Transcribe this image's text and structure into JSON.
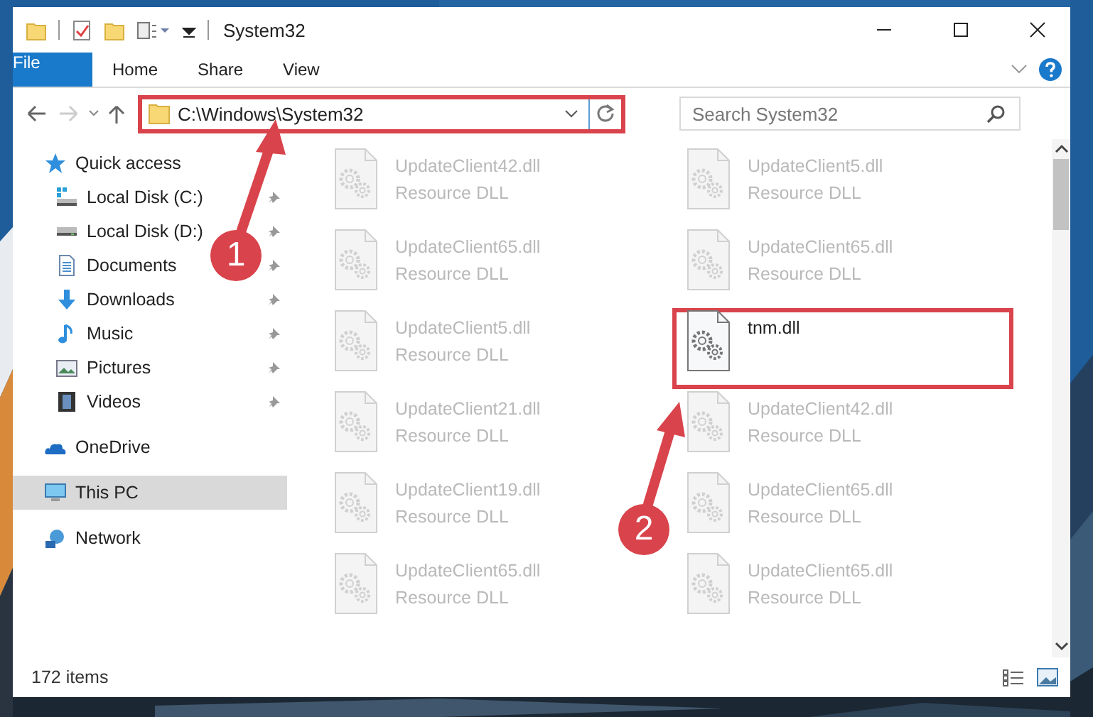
{
  "window": {
    "title": "System32"
  },
  "ribbon": {
    "tabs": [
      {
        "label": "File",
        "kind": "file",
        "selected": false
      },
      {
        "label": "Home",
        "kind": "tab",
        "selected": false
      },
      {
        "label": "Share",
        "kind": "tab",
        "selected": false
      },
      {
        "label": "View",
        "kind": "tab",
        "selected": false
      }
    ]
  },
  "address_bar": {
    "path": "C:\\Windows\\System32",
    "highlighted": true
  },
  "search": {
    "placeholder": "Search System32"
  },
  "navigation": {
    "items": [
      {
        "label": "Quick access",
        "kind": "star",
        "selected": false,
        "children": [
          {
            "label": "Local Disk (C:)",
            "kind": "drive-c",
            "pinned": true,
            "selected": false
          },
          {
            "label": "Local Disk (D:)",
            "kind": "drive",
            "pinned": true,
            "selected": false
          },
          {
            "label": "Documents",
            "kind": "documents",
            "pinned": true,
            "selected": false
          },
          {
            "label": "Downloads",
            "kind": "downloads",
            "pinned": true,
            "selected": false
          },
          {
            "label": "Music",
            "kind": "music",
            "pinned": true,
            "selected": false
          },
          {
            "label": "Pictures",
            "kind": "pictures",
            "pinned": true,
            "selected": false
          },
          {
            "label": "Videos",
            "kind": "videos",
            "pinned": true,
            "selected": false
          }
        ]
      },
      {
        "label": "OneDrive",
        "kind": "cloud",
        "selected": false
      },
      {
        "label": "This PC",
        "kind": "pc",
        "selected": true
      },
      {
        "label": "Network",
        "kind": "network",
        "selected": false
      }
    ]
  },
  "files": [
    {
      "name": "UpdateClient42.dll",
      "type": "Resource DLL",
      "dimmed": true,
      "highlighted": false
    },
    {
      "name": "UpdateClient5.dll",
      "type": "Resource DLL",
      "dimmed": true,
      "highlighted": false
    },
    {
      "name": "UpdateClient65.dll",
      "type": "Resource DLL",
      "dimmed": true,
      "highlighted": false
    },
    {
      "name": "UpdateClient65.dll",
      "type": "Resource DLL",
      "dimmed": true,
      "highlighted": false
    },
    {
      "name": "UpdateClient5.dll",
      "type": "Resource DLL",
      "dimmed": true,
      "highlighted": false
    },
    {
      "name": "tnm.dll",
      "dimmed": false,
      "highlighted": true
    },
    {
      "name": "UpdateClient21.dll",
      "type": "Resource DLL",
      "dimmed": true,
      "highlighted": false
    },
    {
      "name": "UpdateClient42.dll",
      "type": "Resource DLL",
      "dimmed": true,
      "highlighted": false
    },
    {
      "name": "UpdateClient19.dll",
      "type": "Resource DLL",
      "dimmed": true,
      "highlighted": false
    },
    {
      "name": "UpdateClient65.dll",
      "type": "Resource DLL",
      "dimmed": true,
      "highlighted": false
    },
    {
      "name": "UpdateClient65.dll",
      "type": "Resource DLL",
      "dimmed": true,
      "highlighted": false
    },
    {
      "name": "UpdateClient65.dll",
      "type": "Resource DLL",
      "dimmed": true,
      "highlighted": false
    }
  ],
  "status_bar": {
    "item_count": "172 items"
  },
  "annotations": [
    {
      "number": "1"
    },
    {
      "number": "2"
    }
  ]
}
